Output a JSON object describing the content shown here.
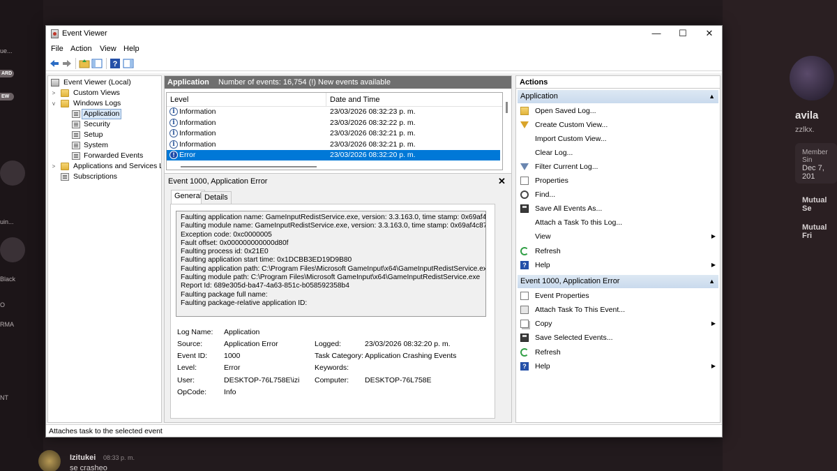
{
  "background": {
    "profile_name": "avila",
    "profile_handle": "zzlkx.",
    "member_since_label": "Member Sin",
    "member_since_value": "Dec 7, 201",
    "mutual_servers": "Mutual Se",
    "mutual_friends": "Mutual Fri",
    "chat_user": "Izitukei",
    "chat_time": "08:33 p. m.",
    "chat_message": "se crasheo",
    "left_badges": [
      "ARD",
      "EW"
    ],
    "left_texts": [
      "ue...",
      "uin...",
      "Black",
      "O",
      "RMA",
      "NT"
    ]
  },
  "window": {
    "title": "Event Viewer",
    "controls": {
      "minimize": "—",
      "maximize": "☐",
      "close": "✕"
    }
  },
  "menu": [
    "File",
    "Action",
    "View",
    "Help"
  ],
  "tree": {
    "root": "Event Viewer (Local)",
    "custom_views": "Custom Views",
    "windows_logs": "Windows Logs",
    "logs": [
      "Application",
      "Security",
      "Setup",
      "System",
      "Forwarded Events"
    ],
    "apps_services": "Applications and Services Lo",
    "subscriptions": "Subscriptions"
  },
  "center": {
    "log_name": "Application",
    "event_count": "Number of events: 16,754 (!) New events available",
    "columns": [
      "Level",
      "Date and Time"
    ],
    "events": [
      {
        "level": "Information",
        "date": "23/03/2026 08:32:23 p. m.",
        "type": "info"
      },
      {
        "level": "Information",
        "date": "23/03/2026 08:32:22 p. m.",
        "type": "info"
      },
      {
        "level": "Information",
        "date": "23/03/2026 08:32:21 p. m.",
        "type": "info"
      },
      {
        "level": "Information",
        "date": "23/03/2026 08:32:21 p. m.",
        "type": "info"
      },
      {
        "level": "Error",
        "date": "23/03/2026 08:32:20 p. m.",
        "type": "error"
      }
    ]
  },
  "detail": {
    "title": "Event 1000, Application Error",
    "tabs": [
      "General",
      "Details"
    ],
    "description": "Faulting application name: GameInputRedistService.exe, version: 3.3.163.0, time stamp: 0x69af4c87\nFaulting module name: GameInputRedistService.exe, version: 3.3.163.0, time stamp: 0x69af4c87\nException code: 0xc0000005\nFault offset: 0x000000000000d80f\nFaulting process id: 0x21E0\nFaulting application start time: 0x1DCBB3ED19D9B80\nFaulting application path: C:\\Program Files\\Microsoft GameInput\\x64\\GameInputRedistService.exe\nFaulting module path: C:\\Program Files\\Microsoft GameInput\\x64\\GameInputRedistService.exe\nReport Id: 689e305d-ba47-4a63-851c-b058592358b4\nFaulting package full name:\nFaulting package-relative application ID:",
    "props": {
      "log_name_label": "Log Name:",
      "log_name": "Application",
      "source_label": "Source:",
      "source": "Application Error",
      "logged_label": "Logged:",
      "logged": "23/03/2026 08:32:20 p. m.",
      "event_id_label": "Event ID:",
      "event_id": "1000",
      "task_category_label": "Task Category:",
      "task_category": "Application Crashing Events",
      "level_label": "Level:",
      "level": "Error",
      "keywords_label": "Keywords:",
      "keywords": "",
      "user_label": "User:",
      "user": "DESKTOP-76L758E\\izi",
      "computer_label": "Computer:",
      "computer": "DESKTOP-76L758E",
      "opcode_label": "OpCode:",
      "opcode": "Info"
    }
  },
  "actions": {
    "title": "Actions",
    "section1": "Application",
    "items1": [
      {
        "label": "Open Saved Log...",
        "icon": "folder-icon"
      },
      {
        "label": "Create Custom View...",
        "icon": "funnel-icon"
      },
      {
        "label": "Import Custom View...",
        "icon": ""
      },
      {
        "label": "Clear Log...",
        "icon": ""
      },
      {
        "label": "Filter Current Log...",
        "icon": "filter-icon"
      },
      {
        "label": "Properties",
        "icon": "properties-icon"
      },
      {
        "label": "Find...",
        "icon": "find-icon"
      },
      {
        "label": "Save All Events As...",
        "icon": "save-icon"
      },
      {
        "label": "Attach a Task To this Log...",
        "icon": ""
      },
      {
        "label": "View",
        "icon": "",
        "submenu": true
      },
      {
        "label": "Refresh",
        "icon": "refresh-icon"
      },
      {
        "label": "Help",
        "icon": "help-icon",
        "submenu": true
      }
    ],
    "section2": "Event 1000, Application Error",
    "items2": [
      {
        "label": "Event Properties",
        "icon": "properties-icon"
      },
      {
        "label": "Attach Task To This Event...",
        "icon": "task-icon"
      },
      {
        "label": "Copy",
        "icon": "copy-icon",
        "submenu": true
      },
      {
        "label": "Save Selected Events...",
        "icon": "save-icon"
      },
      {
        "label": "Refresh",
        "icon": "refresh-icon"
      },
      {
        "label": "Help",
        "icon": "help-icon",
        "submenu": true
      }
    ]
  },
  "status": "Attaches task to the selected event",
  "colors": {
    "selection": "#0078d7",
    "header_gray": "#6f6f6f",
    "section_blue": "#c9daed"
  }
}
